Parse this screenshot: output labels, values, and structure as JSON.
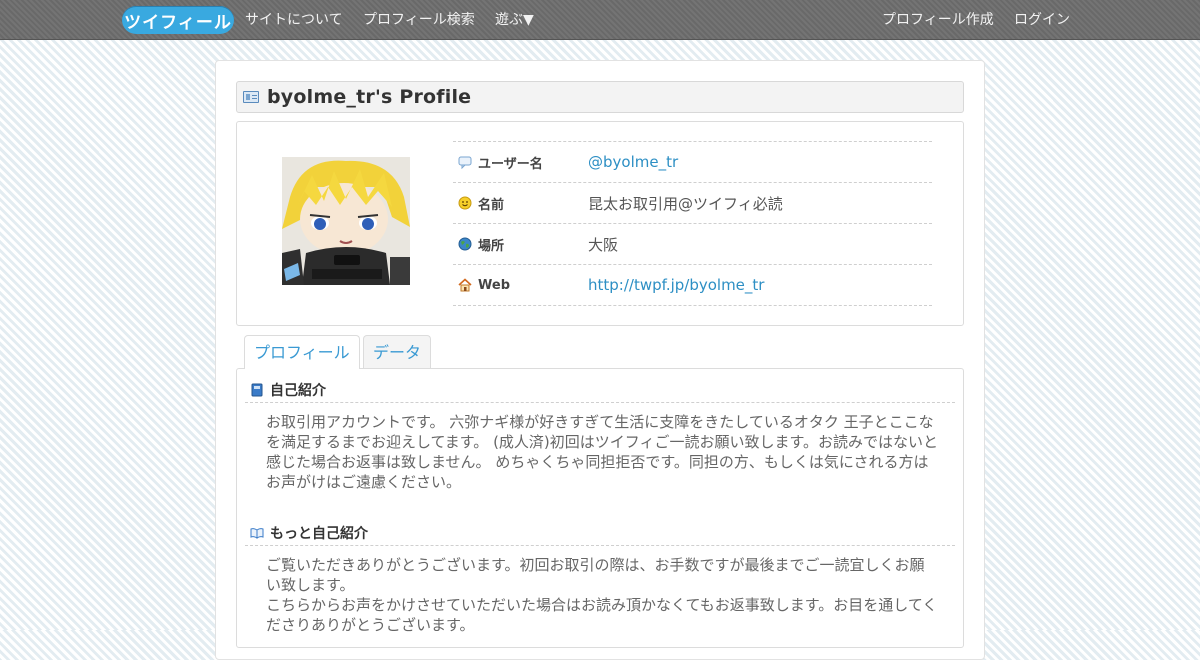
{
  "nav": {
    "logo": "ツイフィール",
    "about": "サイトについて",
    "search": "プロフィール検索",
    "play": "遊ぶ▼",
    "create": "プロフィール作成",
    "login": "ログイン"
  },
  "profile": {
    "title": "byolme_tr's Profile",
    "rows": [
      {
        "label": "ユーザー名",
        "value": "@byolme_tr",
        "icon": "speech-bubble-icon"
      },
      {
        "label": "名前",
        "value": "昆太お取引用@ツイフィ必読",
        "icon": "smiley-icon"
      },
      {
        "label": "場所",
        "value": "大阪",
        "icon": "globe-icon"
      },
      {
        "label": "Web",
        "value": "http://twpf.jp/byolme_tr",
        "icon": "home-icon"
      }
    ]
  },
  "tabs": {
    "profile": "プロフィール",
    "data": "データ"
  },
  "sections": {
    "intro_title": "自己紹介",
    "intro_body": "お取引用アカウントです。 六弥ナギ様が好きすぎて生活に支障をきたしているオタク 王子とここなを満足するまでお迎えしてます。 (成人済)初回はツイフィご一読お願い致します。お読みではないと感じた場合お返事は致しません。 めちゃくちゃ同担拒否です。同担の方、もしくは気にされる方はお声がけはご遠慮ください。",
    "more_title": "もっと自己紹介",
    "more_body_1": "ご覧いただきありがとうございます。初回お取引の際は、お手数ですが最後までご一読宜しくお願い致します。",
    "more_body_2": "こちらからお声をかけさせていただいた場合はお読み頂かなくてもお返事致します。お目を通してくださりありがとうございます。"
  },
  "colors": {
    "link": "#2d8fc4",
    "nav_bg": "#6d6d6d",
    "logo_bg": "#39a9e0"
  }
}
